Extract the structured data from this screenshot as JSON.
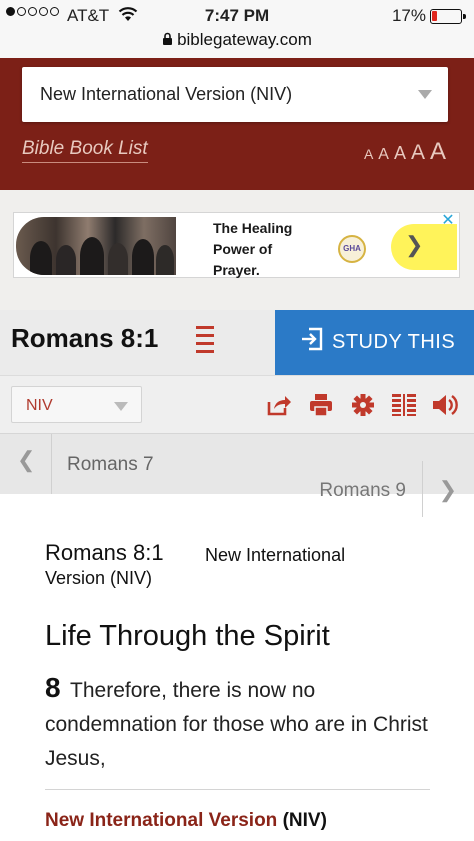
{
  "status_bar": {
    "carrier": "AT&T",
    "time": "7:47 PM",
    "battery_percent": "17%",
    "battery_level": 0.17,
    "url": "biblegateway.com"
  },
  "header": {
    "version_select": "New International Version (NIV)",
    "book_list_link": "Bible Book List",
    "font_size_options": [
      "A",
      "A",
      "A",
      "A",
      "A"
    ]
  },
  "ad": {
    "text_lines": [
      "The Healing",
      "Power of",
      "Prayer."
    ],
    "logo_text": "GHA"
  },
  "passage": {
    "reference": "Romans 8:1",
    "study_button": "STUDY THIS"
  },
  "toolbar": {
    "version_select": "NIV",
    "icons": [
      "share-icon",
      "print-icon",
      "gear-icon",
      "parallel-icon",
      "audio-icon"
    ]
  },
  "navigation": {
    "previous": "Romans 7",
    "next": "Romans 9"
  },
  "content": {
    "reference": "Romans 8:1",
    "version": "New International Version (NIV)",
    "section_title": "Life Through the Spirit",
    "verse_number": "8",
    "verse_text": "Therefore, there is now no condemnation for those who are in Christ Jesus,",
    "footer_version_name": "New International Version",
    "footer_version_abbr": "(NIV)"
  },
  "colors": {
    "header_red": "#7c2017",
    "study_blue": "#2b7ac7",
    "accent_red": "#c0392b"
  }
}
